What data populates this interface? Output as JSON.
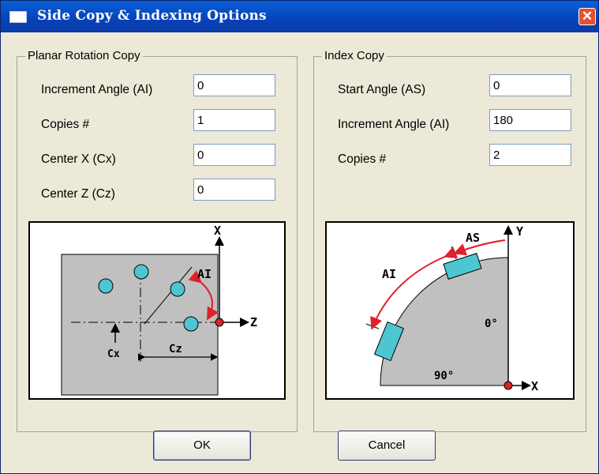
{
  "window": {
    "title": "Side Copy & Indexing Options",
    "close_glyph": "✕"
  },
  "planar": {
    "group_title": "Planar Rotation Copy",
    "rows": [
      {
        "label": "Increment Angle (AI)",
        "value": "0"
      },
      {
        "label": "Copies #",
        "value": "1"
      },
      {
        "label": "Center X (Cx)",
        "value": "0"
      },
      {
        "label": "Center Z (Cz)",
        "value": "0"
      }
    ],
    "diagram": {
      "axis_x": "X",
      "axis_z": "Z",
      "label_ai": "AI",
      "label_cx": "Cx",
      "label_cz": "Cz"
    }
  },
  "index": {
    "group_title": "Index Copy",
    "rows": [
      {
        "label": "Start Angle (AS)",
        "value": "0"
      },
      {
        "label": "Increment Angle (AI)",
        "value": "180"
      },
      {
        "label": "Copies #",
        "value": "2"
      }
    ],
    "diagram": {
      "axis_y": "Y",
      "axis_x": "X",
      "label_as": "AS",
      "label_ai": "AI",
      "label_0": "0°",
      "label_90": "90°"
    }
  },
  "buttons": {
    "ok": "OK",
    "cancel": "Cancel"
  },
  "colors": {
    "titlebar": "#0a4fc8",
    "dialog_bg": "#ece9d8",
    "diagram_fill": "#c0c0c0",
    "hole_fill": "#4ec6d2",
    "arrow_red": "#e0202a"
  }
}
